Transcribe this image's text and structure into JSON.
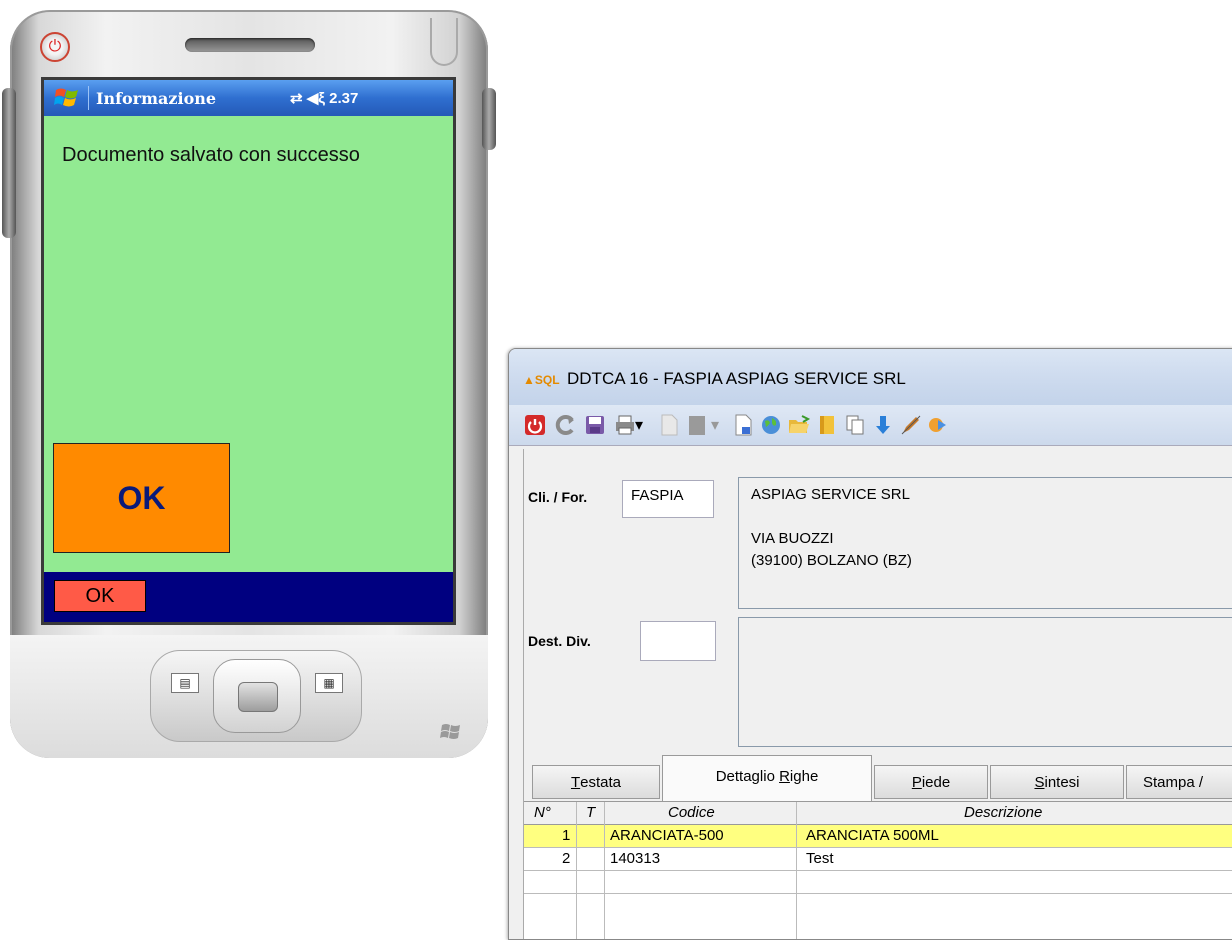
{
  "pda": {
    "title": "Informazione",
    "status_time": "2.37",
    "message": "Documento salvato con successo",
    "big_ok_label": "OK",
    "softkey_left": "OK",
    "colors": {
      "screen_bg": "#92ea92",
      "ok_button": "#ff8a00",
      "softkey": "#ff5a47",
      "bottom_bar": "#000080"
    }
  },
  "window": {
    "title": "DDTCA 16 - FASPIA ASPIAG SERVICE SRL",
    "app_icon": {
      "top": "SQL"
    },
    "toolbar": [
      "power-icon",
      "refresh-icon",
      "save-icon",
      "print-icon",
      "print-dropdown-icon",
      "document-icon",
      "document-gray-icon",
      "dropdown-icon",
      "page-icon",
      "globe-icon",
      "folder-open-icon",
      "book-icon",
      "copy-icon",
      "arrow-down-icon",
      "edit-icon",
      "export-icon"
    ],
    "customer": {
      "label": "Cli. / For.",
      "code": "FASPIA",
      "name": "ASPIAG SERVICE SRL",
      "address": "VIA BUOZZI",
      "city": "(39100)  BOLZANO (BZ)"
    },
    "destination": {
      "label": "Dest. Div.",
      "code": ""
    },
    "tabs": [
      {
        "label": "Testata",
        "hotkey": "T"
      },
      {
        "label": "Dettaglio Righe",
        "hotkey": "R"
      },
      {
        "label": "Piede",
        "hotkey": "P"
      },
      {
        "label": "Sintesi",
        "hotkey": "S"
      },
      {
        "label": "Stampa /"
      }
    ],
    "grid": {
      "columns": [
        "N°",
        "T",
        "Codice",
        "Descrizione"
      ],
      "rows": [
        {
          "n": "1",
          "t": "",
          "codice": "ARANCIATA-500",
          "descrizione": "ARANCIATA 500ML",
          "selected": true
        },
        {
          "n": "2",
          "t": "",
          "codice": "140313",
          "descrizione": "Test",
          "selected": false
        }
      ]
    }
  }
}
